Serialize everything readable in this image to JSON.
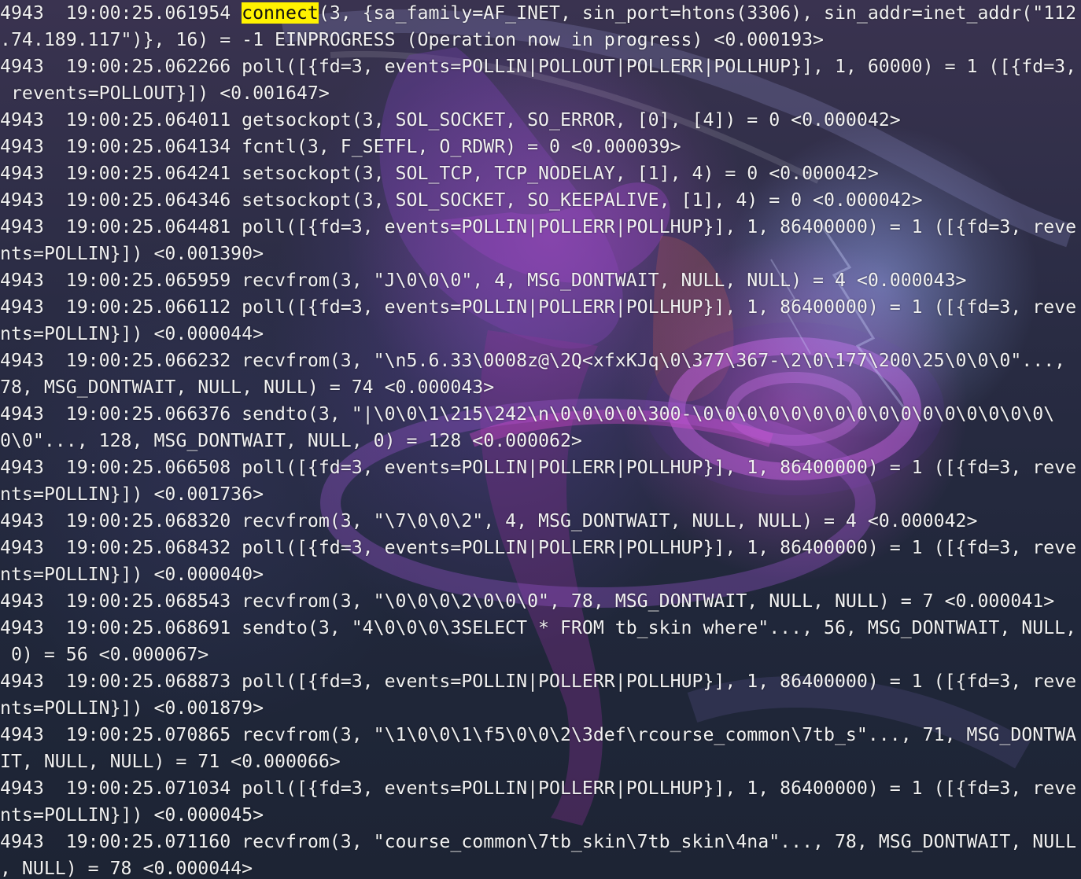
{
  "terminal": {
    "highlight": {
      "before": "4943  19:00:25.061954 ",
      "word": "connect",
      "after": "(3, {sa_family=AF_INET, sin_port=htons(3306), sin_addr=inet_addr(\"112"
    },
    "lines": [
      ".74.189.117\")}, 16) = -1 EINPROGRESS (Operation now in progress) <0.000193>",
      "4943  19:00:25.062266 poll([{fd=3, events=POLLIN|POLLOUT|POLLERR|POLLHUP}], 1, 60000) = 1 ([{fd=3,",
      " revents=POLLOUT}]) <0.001647>",
      "4943  19:00:25.064011 getsockopt(3, SOL_SOCKET, SO_ERROR, [0], [4]) = 0 <0.000042>",
      "4943  19:00:25.064134 fcntl(3, F_SETFL, O_RDWR) = 0 <0.000039>",
      "4943  19:00:25.064241 setsockopt(3, SOL_TCP, TCP_NODELAY, [1], 4) = 0 <0.000042>",
      "4943  19:00:25.064346 setsockopt(3, SOL_SOCKET, SO_KEEPALIVE, [1], 4) = 0 <0.000042>",
      "4943  19:00:25.064481 poll([{fd=3, events=POLLIN|POLLERR|POLLHUP}], 1, 86400000) = 1 ([{fd=3, reve",
      "nts=POLLIN}]) <0.001390>",
      "4943  19:00:25.065959 recvfrom(3, \"J\\0\\0\\0\", 4, MSG_DONTWAIT, NULL, NULL) = 4 <0.000043>",
      "4943  19:00:25.066112 poll([{fd=3, events=POLLIN|POLLERR|POLLHUP}], 1, 86400000) = 1 ([{fd=3, reve",
      "nts=POLLIN}]) <0.000044>",
      "4943  19:00:25.066232 recvfrom(3, \"\\n5.6.33\\0008z@\\2Q<xfxKJq\\0\\377\\367-\\2\\0\\177\\200\\25\\0\\0\\0\"...,",
      "78, MSG_DONTWAIT, NULL, NULL) = 74 <0.000043>",
      "4943  19:00:25.066376 sendto(3, \"|\\0\\0\\1\\215\\242\\n\\0\\0\\0\\0\\300-\\0\\0\\0\\0\\0\\0\\0\\0\\0\\0\\0\\0\\0\\0\\0\\0\\",
      "0\\0\"..., 128, MSG_DONTWAIT, NULL, 0) = 128 <0.000062>",
      "4943  19:00:25.066508 poll([{fd=3, events=POLLIN|POLLERR|POLLHUP}], 1, 86400000) = 1 ([{fd=3, reve",
      "nts=POLLIN}]) <0.001736>",
      "4943  19:00:25.068320 recvfrom(3, \"\\7\\0\\0\\2\", 4, MSG_DONTWAIT, NULL, NULL) = 4 <0.000042>",
      "4943  19:00:25.068432 poll([{fd=3, events=POLLIN|POLLERR|POLLHUP}], 1, 86400000) = 1 ([{fd=3, reve",
      "nts=POLLIN}]) <0.000040>",
      "4943  19:00:25.068543 recvfrom(3, \"\\0\\0\\0\\2\\0\\0\\0\", 78, MSG_DONTWAIT, NULL, NULL) = 7 <0.000041>",
      "4943  19:00:25.068691 sendto(3, \"4\\0\\0\\0\\3SELECT * FROM tb_skin where\"..., 56, MSG_DONTWAIT, NULL,",
      " 0) = 56 <0.000067>",
      "4943  19:00:25.068873 poll([{fd=3, events=POLLIN|POLLERR|POLLHUP}], 1, 86400000) = 1 ([{fd=3, reve",
      "nts=POLLIN}]) <0.001879>",
      "4943  19:00:25.070865 recvfrom(3, \"\\1\\0\\0\\1\\f5\\0\\0\\2\\3def\\rcourse_common\\7tb_s\"..., 71, MSG_DONTWA",
      "IT, NULL, NULL) = 71 <0.000066>",
      "4943  19:00:25.071034 poll([{fd=3, events=POLLIN|POLLERR|POLLHUP}], 1, 86400000) = 1 ([{fd=3, reve",
      "nts=POLLIN}]) <0.000045>",
      "4943  19:00:25.071160 recvfrom(3, \"course_common\\7tb_skin\\7tb_skin\\4na\"..., 78, MSG_DONTWAIT, NULL",
      ", NULL) = 78 <0.000044>"
    ]
  },
  "colors": {
    "text": "#f1f1f1",
    "highlight_bg": "#fff200",
    "highlight_text": "#111111",
    "background": "#232838"
  }
}
